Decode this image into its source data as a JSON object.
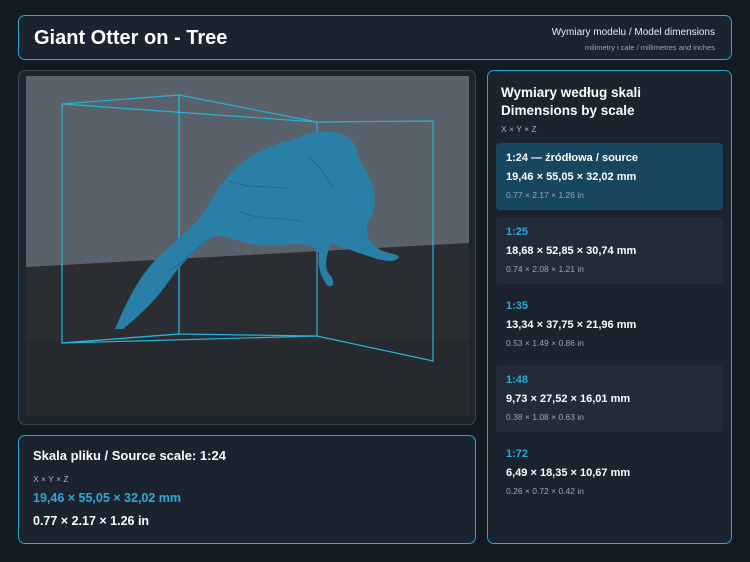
{
  "header": {
    "title": "Giant Otter on - Tree",
    "subtitle": "Wymiary modelu / Model dimensions",
    "units_note": "milimetry i cale / millimetres and inches"
  },
  "viewer": {
    "model_color": "#2a7fa6",
    "bbox_color": "#29b2d6"
  },
  "source": {
    "title": "Skala pliku / Source scale: 1:24",
    "axes": "X × Y × Z",
    "mm": "19,46 × 55,05 × 32,02 mm",
    "inches": "0.77 × 2.17 × 1.26 in"
  },
  "scales": {
    "title_pl": "Wymiary według skali",
    "title_en": "Dimensions by scale",
    "axes": "X × Y × Z",
    "items": [
      {
        "label": "1:24  —  źródłowa / source",
        "mm": "19,46 × 55,05 × 32,02 mm",
        "inches": "0.77 × 2.17 × 1.26 in"
      },
      {
        "label": "1:25",
        "mm": "18,68 × 52,85 × 30,74 mm",
        "inches": "0.74 × 2.08 × 1.21 in"
      },
      {
        "label": "1:35",
        "mm": "13,34 × 37,75 × 21,96 mm",
        "inches": "0.53 × 1.49 × 0.86 in"
      },
      {
        "label": "1:48",
        "mm": "9,73 × 27,52 × 16,01 mm",
        "inches": "0.38 × 1.08 × 0.63 in"
      },
      {
        "label": "1:72",
        "mm": "6,49 × 18,35 × 10,67 mm",
        "inches": "0.26 × 0.72 × 0.42 in"
      }
    ]
  }
}
